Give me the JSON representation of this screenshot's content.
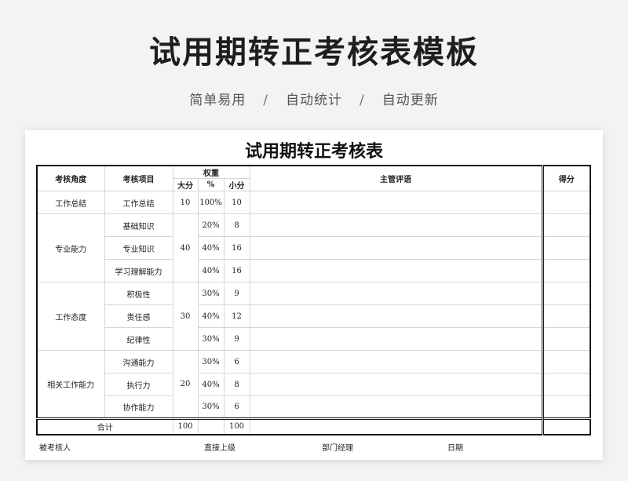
{
  "page": {
    "title": "试用期转正考核表模板",
    "subtitle": [
      "简单易用",
      "自动统计",
      "自动更新"
    ],
    "separator": "/"
  },
  "sheet": {
    "title": "试用期转正考核表",
    "headers": {
      "angle": "考核角度",
      "item": "考核项目",
      "weight": "权重",
      "big": "大分",
      "pct": "%",
      "small": "小分",
      "comment": "主管评语",
      "score": "得分"
    },
    "groups": [
      {
        "angle": "工作总结",
        "big": "10",
        "rows": [
          {
            "item": "工作总结",
            "pct": "100%",
            "small": "10"
          }
        ]
      },
      {
        "angle": "专业能力",
        "big": "40",
        "rows": [
          {
            "item": "基础知识",
            "pct": "20%",
            "small": "8"
          },
          {
            "item": "专业知识",
            "pct": "40%",
            "small": "16"
          },
          {
            "item": "学习理解能力",
            "pct": "40%",
            "small": "16"
          }
        ]
      },
      {
        "angle": "工作态度",
        "big": "30",
        "rows": [
          {
            "item": "积极性",
            "pct": "30%",
            "small": "9"
          },
          {
            "item": "责任感",
            "pct": "40%",
            "small": "12"
          },
          {
            "item": "纪律性",
            "pct": "30%",
            "small": "9"
          }
        ]
      },
      {
        "angle": "相关工作能力",
        "big": "20",
        "rows": [
          {
            "item": "沟通能力",
            "pct": "30%",
            "small": "6"
          },
          {
            "item": "执行力",
            "pct": "40%",
            "small": "8"
          },
          {
            "item": "协作能力",
            "pct": "30%",
            "small": "6"
          }
        ]
      }
    ],
    "total": {
      "label": "合计",
      "big": "100",
      "small": "100"
    },
    "footer": [
      "被考核人",
      "直接上级",
      "部门经理",
      "日期"
    ]
  }
}
